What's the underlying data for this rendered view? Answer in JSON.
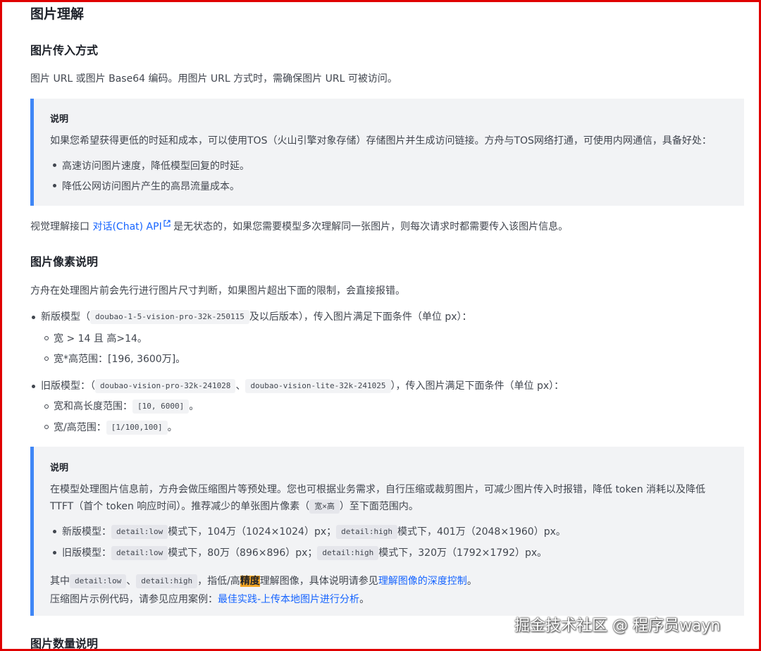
{
  "doc": {
    "section_title": "图片理解",
    "input_heading": "图片传入方式",
    "input_text": "图片 URL 或图片 Base64 编码。用图片 URL 方式时，需确保图片 URL 可被访问。",
    "note1": {
      "title": "说明",
      "text": "如果您希望获得更低的时延和成本，可以使用TOS（火山引擎对象存储）存储图片并生成访问链接。方舟与TOS网络打通，可使用内网通信，具备好处：",
      "bullets": [
        "高速访问图片速度，降低模型回复的时延。",
        "降低公网访问图片产生的高昂流量成本。"
      ]
    },
    "stateless": {
      "prefix": "视觉理解接口",
      "link": "对话(Chat) API",
      "suffix": "是无状态的，如果您需要模型多次理解同一张图片，则每次请求时都需要传入该图片信息。"
    },
    "pixel_heading": "图片像素说明",
    "pixel_text": "方舟在处理图片前会先行进行图片尺寸判断，如果图片超出下面的限制，会直接报错。",
    "new_model": {
      "prefix": "新版模型（",
      "code": "doubao-1-5-vision-pro-32k-250115",
      "suffix": "及以后版本），传入图片满足下面条件（单位 px）：",
      "sub1": "宽 > 14 且 高>14。",
      "sub2": "宽*高范围：[196, 3600万]。"
    },
    "old_model": {
      "prefix": "旧版模型：（",
      "code1": "doubao-vision-pro-32k-241028",
      "sep": "、",
      "code2": "doubao-vision-lite-32k-241025",
      "suffix": "），传入图片满足下面条件（单位 px）：",
      "sub1_prefix": "宽和高长度范围：",
      "sub1_code": "[10, 6000]",
      "sub1_suffix": "。",
      "sub2_prefix": "宽/高范围：",
      "sub2_code": "[1/100,100]",
      "sub2_suffix": "。"
    },
    "note2": {
      "title": "说明",
      "line1": "在模型处理图片信息前，方舟会做压缩图片等预处理。您也可根据业务需求，自行压缩或裁剪图片，可减少图片传入时报错，降低 token 消耗以及降低",
      "line2_prefix": "TTFT（首个 token 响应时间）。推荐减少的单张图片像素（",
      "line2_code": "宽×高",
      "line2_suffix": "）至下面范围内。",
      "b1_prefix": "新版模型：",
      "b1_code1": "detail:low",
      "b1_mid": "模式下，104万（1024×1024）px；",
      "b1_code2": "detail:high",
      "b1_suffix": "模式下，401万（2048×1960）px。",
      "b2_prefix": "旧版模型：",
      "b2_code1": "detail:low",
      "b2_mid": "模式下，80万（896×896）px；",
      "b2_code2": "detail:high",
      "b2_suffix": "模式下，320万（1792×1792）px。",
      "detail_prefix": "其中",
      "detail_code1": "detail:low",
      "detail_sep": "、",
      "detail_code2": "detail:high",
      "detail_mid1": "，指低/高",
      "detail_hl": "精度",
      "detail_mid2": "理解图像，具体说明请参见",
      "detail_link": "理解图像的深度控制",
      "detail_suffix": "。",
      "example_prefix": "压缩图片示例代码，请参见应用案例：",
      "example_link": "最佳实践-上传本地图片进行分析",
      "example_suffix": "。"
    },
    "count_heading": "图片数量说明",
    "watermark": "掘金技术社区 @ 程序员wayn"
  },
  "colors": {
    "accent": "#3f86f6",
    "link": "#1664ff",
    "highlight": "#f5a623",
    "frame": "#e00000",
    "note_bg": "#f2f3f5"
  }
}
